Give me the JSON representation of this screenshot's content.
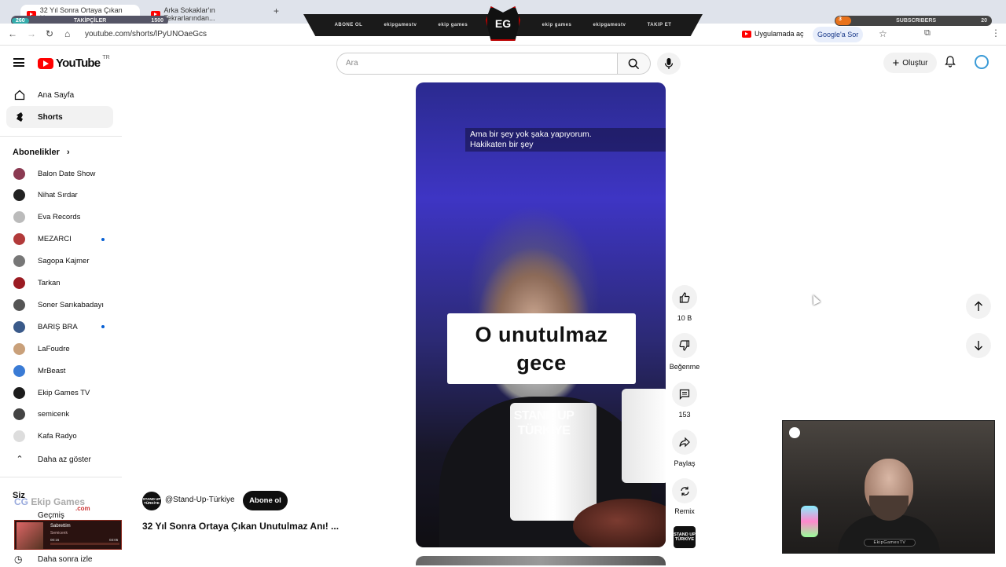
{
  "browser": {
    "tabs": [
      {
        "title": "32 Yıl Sonra Ortaya Çıkan U..."
      },
      {
        "title": "Arka Sokaklar'ın Tekrarlarından..."
      }
    ],
    "url": "youtube.com/shorts/lPyUNOaeGcs",
    "open_in_app": "Uygulamada aç",
    "ask_google": "Google'a Sor",
    "new_tab_symbol": "+"
  },
  "stream_overlay": {
    "banner_items": [
      "ABONE OL",
      "ekipgamestv",
      "ekip games",
      "ekip games",
      "ekipgamestv",
      "TAKIP ET"
    ],
    "logo": "EG",
    "followers_label": "TAKİPÇİLER",
    "followers_left": "260",
    "followers_right": "1500",
    "subscribers_label": "SUBSCRIBERS",
    "subscribers_left": "3",
    "subscribers_right": "20",
    "bottom_brand": "Ekip Games",
    "bottom_brand_suffix": ".com",
    "webcam_tag": "EkipGamesTV",
    "music_title": "Sabrettim",
    "music_artist": "Semicenk",
    "music_time_start": "00:16",
    "music_time_end": "03:05"
  },
  "header": {
    "logo_text": "YouTube",
    "region": "TR",
    "search_placeholder": "Ara",
    "create_label": "Oluştur"
  },
  "sidebar": {
    "main": [
      {
        "label": "Ana Sayfa"
      },
      {
        "label": "Shorts"
      }
    ],
    "subs_title": "Abonelikler",
    "subscriptions": [
      {
        "label": "Balon Date Show",
        "color": "#8b3a52",
        "dot": false
      },
      {
        "label": "Nihat Sırdar",
        "color": "#222222",
        "dot": false
      },
      {
        "label": "Eva Records",
        "color": "#bbbbbb",
        "dot": false
      },
      {
        "label": "MEZARCI",
        "color": "#b23a3a",
        "dot": true
      },
      {
        "label": "Sagopa Kajmer",
        "color": "#777777",
        "dot": false
      },
      {
        "label": "Tarkan",
        "color": "#9b1b22",
        "dot": false
      },
      {
        "label": "Soner Sarıkabadayı",
        "color": "#555555",
        "dot": false
      },
      {
        "label": "BARIŞ BRA",
        "color": "#3a5a8a",
        "dot": true
      },
      {
        "label": "LaFoudre",
        "color": "#c9a07a",
        "dot": false
      },
      {
        "label": "MrBeast",
        "color": "#3a7bd5",
        "dot": false
      },
      {
        "label": "Ekip Games TV",
        "color": "#1c1c1c",
        "dot": false
      },
      {
        "label": "semicenk",
        "color": "#444444",
        "dot": false
      },
      {
        "label": "Kafa Radyo",
        "color": "#dddddd",
        "dot": false
      }
    ],
    "show_less": "Daha az göster",
    "you_title": "Siz",
    "history": "Geçmiş",
    "watch_later": "Daha sonra izle"
  },
  "video": {
    "caption_top": "Ama bir şey yok şaka yapıyorum.\nHakikaten bir şey",
    "caption_main": "O unutulmaz gece",
    "watermark": "STAND UP TÜRKİYE",
    "channel_handle": "@Stand-Up-Türkiye",
    "channel_avatar_text": "STAND UP TÜRKİYE",
    "subscribe_label": "Abone ol",
    "title": "32 Yıl Sonra Ortaya Çıkan Unutulmaz Anı! ..."
  },
  "actions": {
    "like_count": "10 B",
    "dislike_label": "Beğenme",
    "comments_count": "153",
    "share_label": "Paylaş",
    "remix_label": "Remix"
  }
}
